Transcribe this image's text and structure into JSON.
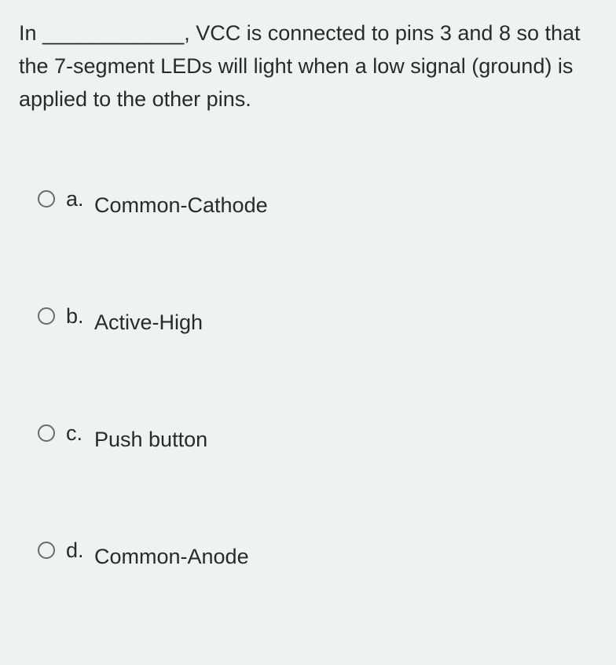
{
  "question": {
    "text": "In ____________, VCC is connected to pins 3 and 8 so that the 7-segment LEDs will light when a low signal (ground) is applied to the other pins."
  },
  "options": [
    {
      "letter": "a.",
      "text": "Common-Cathode"
    },
    {
      "letter": "b.",
      "text": "Active-High"
    },
    {
      "letter": "c.",
      "text": "Push button"
    },
    {
      "letter": "d.",
      "text": "Common-Anode"
    }
  ]
}
